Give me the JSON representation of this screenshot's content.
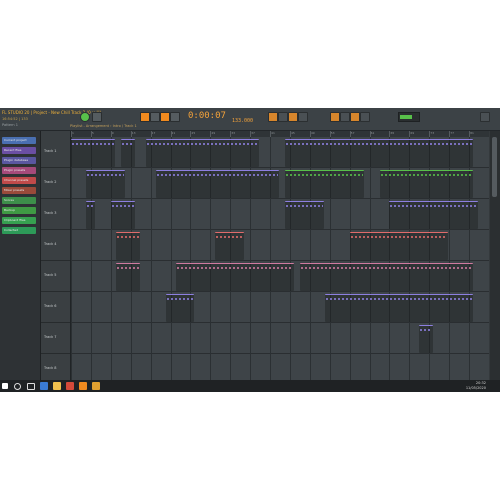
{
  "window": {
    "title": "FL STUDIO 20 | Project - New Chill Track 2 (0 × H)",
    "subtitle": "16:54:52 | 133",
    "hint": "Playlist - Arrangement › Intro / Track 1"
  },
  "toolbar": {
    "time": "0:00:07",
    "tempo": "133.000",
    "pattern": "Pattern 1"
  },
  "browser": {
    "items": [
      {
        "label": "Current project",
        "color": "#4a6fb0"
      },
      {
        "label": "Recent files",
        "color": "#6b4fa3"
      },
      {
        "label": "Plugin database",
        "color": "#5a57a0"
      },
      {
        "label": "Plugin presets",
        "color": "#a54a7a"
      },
      {
        "label": "Channel presets",
        "color": "#c04a4a"
      },
      {
        "label": "Mixer presets",
        "color": "#9a4a3a"
      },
      {
        "label": "Scores",
        "color": "#3d8f4a"
      },
      {
        "label": "Backup",
        "color": "#3f9a44"
      },
      {
        "label": "Clipboard files",
        "color": "#36a050"
      },
      {
        "label": "Collected",
        "color": "#2d9a58"
      }
    ]
  },
  "tracks": [
    {
      "label": "Track 1"
    },
    {
      "label": "Track 2"
    },
    {
      "label": "Track 3"
    },
    {
      "label": "Track 4"
    },
    {
      "label": "Track 5"
    },
    {
      "label": "Track 6"
    },
    {
      "label": "Track 7"
    },
    {
      "label": "Track 8"
    }
  ],
  "ruler": {
    "bars": [
      "1",
      "5",
      "9",
      "13",
      "17",
      "21",
      "25",
      "29",
      "33",
      "37",
      "41",
      "45",
      "49",
      "53",
      "57",
      "61",
      "65",
      "69",
      "73",
      "77",
      "81"
    ]
  },
  "colors": {
    "orange": "#f08a1f",
    "clip_blue": "#8d7fe0",
    "clip_green": "#58c04a",
    "clip_red": "#e06b6b",
    "clip_pink": "#d07aa0"
  },
  "clips": [
    {
      "track": 0,
      "start": 0,
      "len": 9,
      "color": "#8d7fe0",
      "label": "Pad"
    },
    {
      "track": 0,
      "start": 10,
      "len": 3,
      "color": "#8d7fe0",
      "label": "Pad"
    },
    {
      "track": 0,
      "start": 15,
      "len": 23,
      "color": "#8d7fe0",
      "label": "Pad"
    },
    {
      "track": 0,
      "start": 43,
      "len": 38,
      "color": "#8d7fe0",
      "label": "Pad"
    },
    {
      "track": 1,
      "start": 3,
      "len": 8,
      "color": "#8d7fe0",
      "label": "Chords"
    },
    {
      "track": 1,
      "start": 17,
      "len": 25,
      "color": "#8d7fe0",
      "label": "Chords"
    },
    {
      "track": 1,
      "start": 43,
      "len": 16,
      "color": "#58c04a",
      "label": "Lead"
    },
    {
      "track": 1,
      "start": 62,
      "len": 19,
      "color": "#58c04a",
      "label": "Lead"
    },
    {
      "track": 2,
      "start": 3,
      "len": 2,
      "color": "#8d7fe0",
      "label": "Fx"
    },
    {
      "track": 2,
      "start": 8,
      "len": 5,
      "color": "#8d7fe0",
      "label": "Fx"
    },
    {
      "track": 2,
      "start": 43,
      "len": 8,
      "color": "#8d7fe0",
      "label": "Fx"
    },
    {
      "track": 2,
      "start": 64,
      "len": 18,
      "color": "#8d7fe0",
      "label": "Fx"
    },
    {
      "track": 3,
      "start": 9,
      "len": 5,
      "color": "#e06b6b",
      "label": "Kick"
    },
    {
      "track": 3,
      "start": 29,
      "len": 6,
      "color": "#e06b6b",
      "label": "Kick"
    },
    {
      "track": 3,
      "start": 56,
      "len": 20,
      "color": "#e06b6b",
      "label": "Kick"
    },
    {
      "track": 4,
      "start": 9,
      "len": 5,
      "color": "#d07aa0",
      "label": "Snare"
    },
    {
      "track": 4,
      "start": 21,
      "len": 24,
      "color": "#d07aa0",
      "label": "Snare"
    },
    {
      "track": 4,
      "start": 46,
      "len": 35,
      "color": "#d07aa0",
      "label": "Snare"
    },
    {
      "track": 5,
      "start": 19,
      "len": 6,
      "color": "#8d7fe0",
      "label": "Hat"
    },
    {
      "track": 5,
      "start": 51,
      "len": 30,
      "color": "#8d7fe0",
      "label": "Hat"
    },
    {
      "track": 6,
      "start": 70,
      "len": 3,
      "color": "#8d7fe0",
      "label": "Vox"
    }
  ],
  "taskbar": {
    "time": "20:32",
    "date": "11/05/2020"
  }
}
